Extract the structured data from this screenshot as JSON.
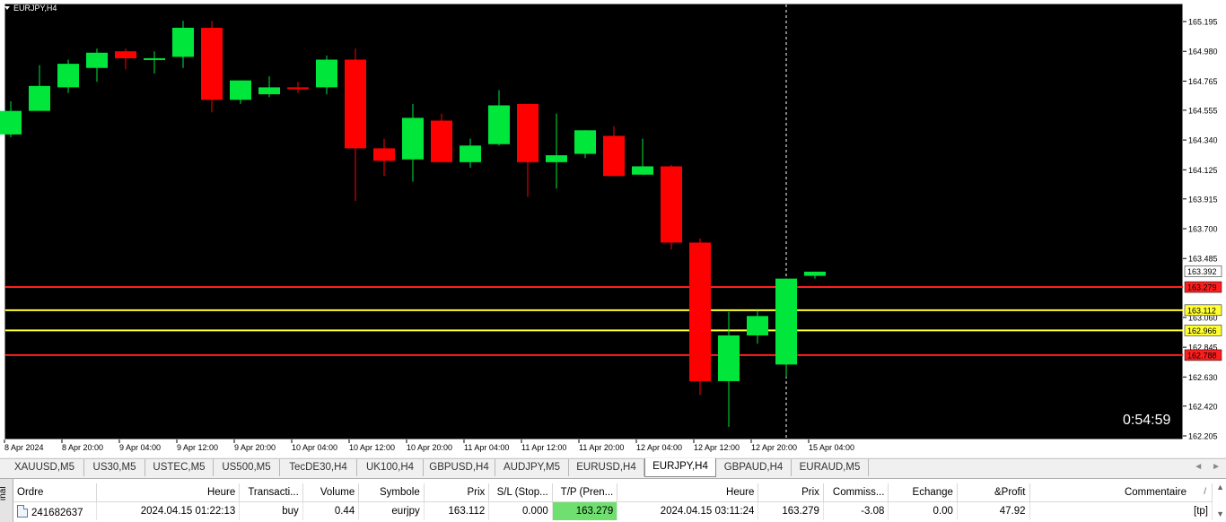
{
  "chart": {
    "title": "EURJPY,H4",
    "timer": "0:54:59",
    "colors": {
      "background": "#000000",
      "bull": "#00e63a",
      "bear": "#ff0000",
      "grid": "#ffffff",
      "tp_line": "#ff1e1e",
      "entry_line": "#ffff33"
    },
    "price_axis": [
      "165.195",
      "164.980",
      "164.765",
      "164.555",
      "164.340",
      "164.125",
      "163.915",
      "163.700",
      "163.485",
      "163.060",
      "162.845",
      "162.630",
      "162.420",
      "162.205"
    ],
    "time_axis": [
      "8 Apr 2024",
      "8 Apr 20:00",
      "9 Apr 04:00",
      "9 Apr 12:00",
      "9 Apr 20:00",
      "10 Apr 04:00",
      "10 Apr 12:00",
      "10 Apr 20:00",
      "11 Apr 04:00",
      "11 Apr 12:00",
      "11 Apr 20:00",
      "12 Apr 04:00",
      "12 Apr 12:00",
      "12 Apr 20:00",
      "15 Apr 04:00"
    ],
    "price_labels": [
      {
        "text": "163.392",
        "bg": "#ffffff",
        "fg": "#000000"
      },
      {
        "text": "163.279",
        "bg": "#ff1e1e",
        "fg": "#000000"
      },
      {
        "text": "163.112",
        "bg": "#ffff33",
        "fg": "#000000"
      },
      {
        "text": "162.966",
        "bg": "#ffff33",
        "fg": "#000000"
      },
      {
        "text": "162.788",
        "bg": "#ff1e1e",
        "fg": "#000000"
      }
    ]
  },
  "chart_data": {
    "type": "candlestick",
    "title": "EURJPY,H4",
    "ylim": [
      162.2,
      165.25
    ],
    "bar_times": [
      "8 Apr 08:00",
      "8 Apr 12:00",
      "8 Apr 16:00",
      "8 Apr 20:00",
      "9 Apr 00:00",
      "9 Apr 04:00",
      "9 Apr 08:00",
      "9 Apr 12:00",
      "9 Apr 16:00",
      "9 Apr 20:00",
      "10 Apr 00:00",
      "10 Apr 04:00",
      "10 Apr 08:00",
      "10 Apr 12:00",
      "10 Apr 16:00",
      "10 Apr 20:00",
      "11 Apr 00:00",
      "11 Apr 04:00",
      "11 Apr 08:00",
      "11 Apr 12:00",
      "11 Apr 16:00",
      "11 Apr 20:00",
      "12 Apr 00:00",
      "12 Apr 04:00",
      "12 Apr 08:00",
      "12 Apr 12:00",
      "12 Apr 16:00",
      "12 Apr 20:00",
      "15 Apr 00:00"
    ],
    "candles": [
      {
        "o": 164.38,
        "h": 164.62,
        "l": 164.36,
        "c": 164.55
      },
      {
        "o": 164.55,
        "h": 164.88,
        "l": 164.55,
        "c": 164.73
      },
      {
        "o": 164.72,
        "h": 164.92,
        "l": 164.68,
        "c": 164.89
      },
      {
        "o": 164.86,
        "h": 165.0,
        "l": 164.76,
        "c": 164.97
      },
      {
        "o": 164.98,
        "h": 165.0,
        "l": 164.85,
        "c": 164.93
      },
      {
        "o": 164.92,
        "h": 164.98,
        "l": 164.82,
        "c": 164.93
      },
      {
        "o": 164.94,
        "h": 165.2,
        "l": 164.86,
        "c": 165.15
      },
      {
        "o": 165.15,
        "h": 165.2,
        "l": 164.54,
        "c": 164.63
      },
      {
        "o": 164.63,
        "h": 164.77,
        "l": 164.6,
        "c": 164.77
      },
      {
        "o": 164.67,
        "h": 164.8,
        "l": 164.65,
        "c": 164.72
      },
      {
        "o": 164.72,
        "h": 164.76,
        "l": 164.68,
        "c": 164.71
      },
      {
        "o": 164.72,
        "h": 164.95,
        "l": 164.67,
        "c": 164.92
      },
      {
        "o": 164.92,
        "h": 165.0,
        "l": 163.9,
        "c": 164.28
      },
      {
        "o": 164.28,
        "h": 164.35,
        "l": 164.08,
        "c": 164.19
      },
      {
        "o": 164.2,
        "h": 164.6,
        "l": 164.04,
        "c": 164.5
      },
      {
        "o": 164.48,
        "h": 164.53,
        "l": 164.18,
        "c": 164.18
      },
      {
        "o": 164.18,
        "h": 164.35,
        "l": 164.14,
        "c": 164.3
      },
      {
        "o": 164.31,
        "h": 164.7,
        "l": 164.3,
        "c": 164.59
      },
      {
        "o": 164.6,
        "h": 164.6,
        "l": 163.93,
        "c": 164.18
      },
      {
        "o": 164.18,
        "h": 164.53,
        "l": 163.99,
        "c": 164.23
      },
      {
        "o": 164.24,
        "h": 164.41,
        "l": 164.21,
        "c": 164.41
      },
      {
        "o": 164.37,
        "h": 164.44,
        "l": 164.08,
        "c": 164.08
      },
      {
        "o": 164.09,
        "h": 164.35,
        "l": 164.09,
        "c": 164.15
      },
      {
        "o": 164.15,
        "h": 164.16,
        "l": 163.55,
        "c": 163.6
      },
      {
        "o": 163.6,
        "h": 163.63,
        "l": 162.5,
        "c": 162.6
      },
      {
        "o": 162.6,
        "h": 163.1,
        "l": 162.27,
        "c": 162.93
      },
      {
        "o": 162.93,
        "h": 163.11,
        "l": 162.87,
        "c": 163.07
      },
      {
        "o": 162.72,
        "h": 163.34,
        "l": 162.63,
        "c": 163.34
      },
      {
        "o": 163.36,
        "h": 163.39,
        "l": 163.34,
        "c": 163.39
      }
    ],
    "horizontal_lines": [
      {
        "price": 163.279,
        "label": "163.279",
        "color": "#ff1e1e"
      },
      {
        "price": 163.112,
        "label": "163.112",
        "color": "#ffff33"
      },
      {
        "price": 162.966,
        "label": "162.966",
        "color": "#ffff33"
      },
      {
        "price": 162.788,
        "label": "162.788",
        "color": "#ff1e1e"
      }
    ],
    "current_price": 163.392,
    "cursor_bar_time": "12 Apr 20:00"
  },
  "tabs": {
    "items": [
      "XAUUSD,M5",
      "US30,M5",
      "USTEC,M5",
      "US500,M5",
      "TecDE30,H4",
      "UK100,H4",
      "GBPUSD,H4",
      "AUDJPY,M5",
      "EURUSD,H4",
      "EURJPY,H4",
      "GBPAUD,H4",
      "EURAUD,M5"
    ],
    "active": "EURJPY,H4",
    "nav_left": "◄",
    "nav_right": "►"
  },
  "terminal": {
    "side_label": "inal",
    "columns": [
      "Ordre",
      "Heure",
      "Transacti...",
      "Volume",
      "Symbole",
      "Prix",
      "S/L (Stop...",
      "T/P (Pren...",
      "Heure",
      "Prix",
      "Commiss...",
      "Echange",
      "&Profit",
      "Commentaire"
    ],
    "sort_arrow": "/",
    "rows": [
      {
        "ordre": "241682637",
        "heure": "2024.04.15 01:22:13",
        "transaction": "buy",
        "volume": "0.44",
        "symbole": "eurjpy",
        "prix": "163.112",
        "sl": "0.000",
        "tp": "163.279",
        "heure_close": "2024.04.15 03:11:24",
        "prix_close": "163.279",
        "commission": "-3.08",
        "echange": "0.00",
        "profit": "47.92",
        "commentaire": "[tp]"
      }
    ]
  }
}
